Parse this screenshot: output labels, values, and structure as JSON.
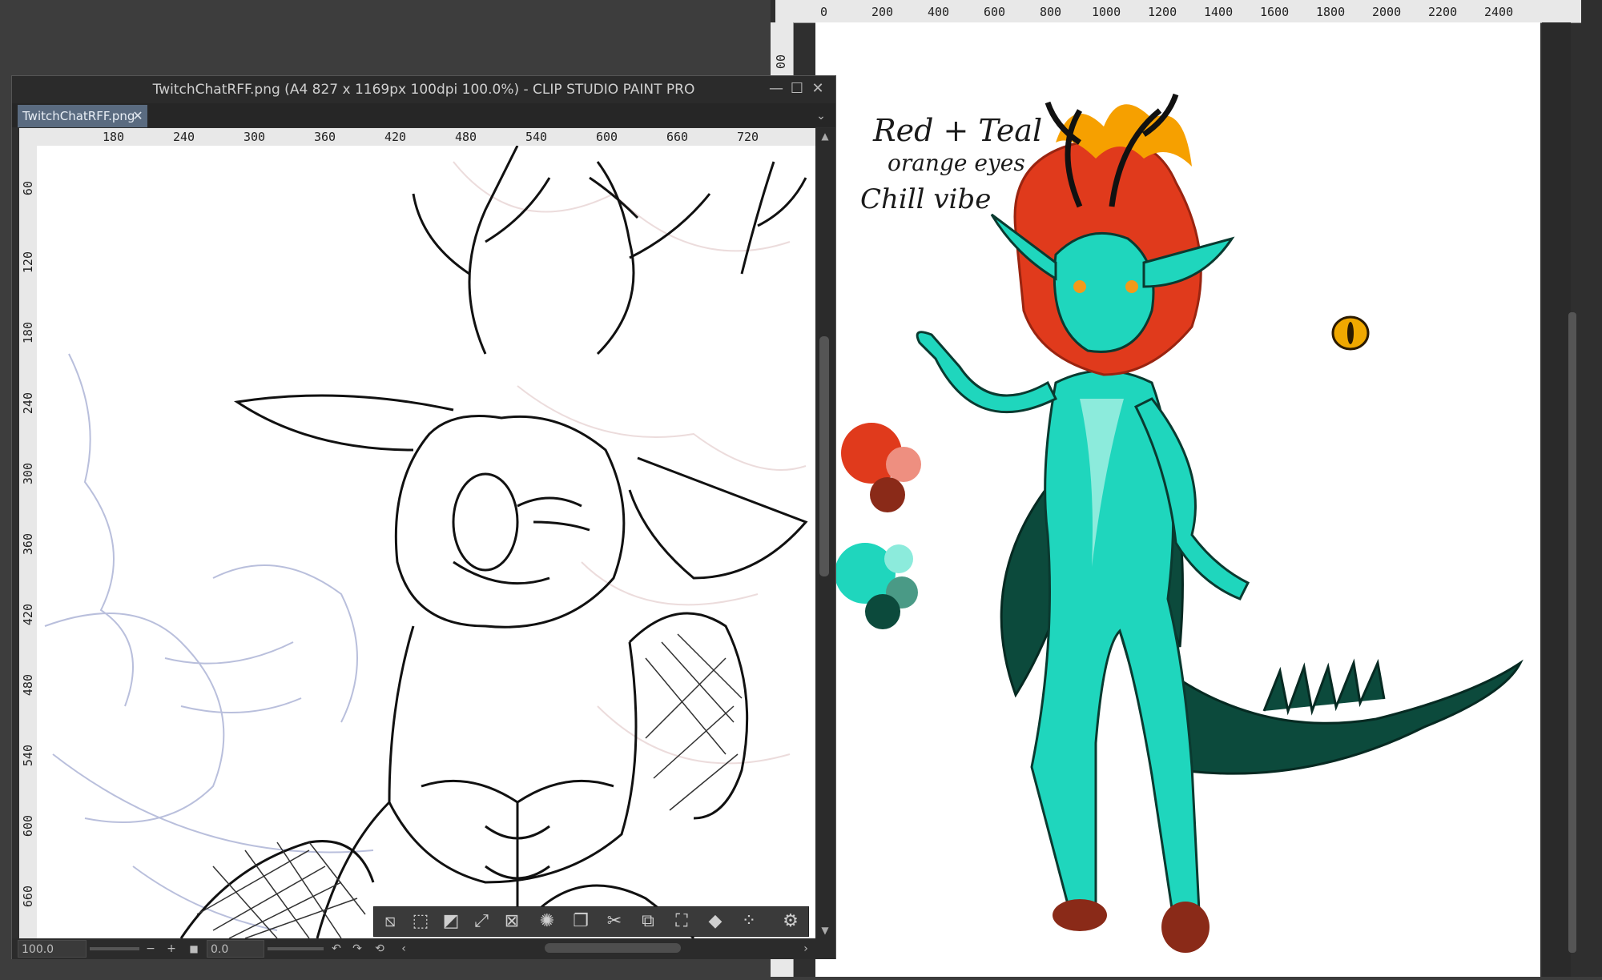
{
  "window": {
    "title": "TwitchChatRFF.png (A4 827 x 1169px 100dpi 100.0%)  - CLIP STUDIO PAINT PRO",
    "controls": {
      "minimize": "—",
      "maximize": "☐",
      "close": "✕"
    }
  },
  "tab": {
    "label": "TwitchChatRFF.png",
    "close": "✕",
    "more": "⌄"
  },
  "front_ruler": {
    "top": [
      "180",
      "240",
      "300",
      "360",
      "420",
      "480",
      "540",
      "600",
      "660",
      "720"
    ],
    "left": [
      "60",
      "120",
      "180",
      "240",
      "300",
      "360",
      "420",
      "480",
      "540",
      "600",
      "660"
    ]
  },
  "back_ruler": {
    "top": [
      "0",
      "200",
      "400",
      "600",
      "800",
      "1000",
      "1200",
      "1400",
      "1600",
      "1800",
      "2000",
      "2200",
      "2400"
    ],
    "left": [
      "00"
    ]
  },
  "status": {
    "zoom": "100.0",
    "zoom_minus": "−",
    "zoom_plus": "+",
    "rotation": "0.0",
    "undo": "↶",
    "redo": "↷"
  },
  "toolbar": {
    "icons": [
      "deselect-icon",
      "selection-icon",
      "invert-selection-icon",
      "expand-selection-icon",
      "shrink-selection-icon",
      "magic-wand-icon",
      "copy-icon",
      "cut-icon",
      "paste-icon",
      "transform-icon",
      "fill-icon",
      "dotted-selection-icon",
      "settings-icon"
    ]
  },
  "reference_notes": {
    "line1": "Red + Teal",
    "line2": "orange eyes",
    "line3": "Chill vibe"
  },
  "palette": {
    "red": "#e03a1c",
    "pink": "#ee8f80",
    "darkred": "#8a2a18",
    "teal": "#1fd6bd",
    "lightteal": "#8cebdc",
    "midteal": "#4a9a86",
    "darkteal": "#0c4a3c"
  }
}
